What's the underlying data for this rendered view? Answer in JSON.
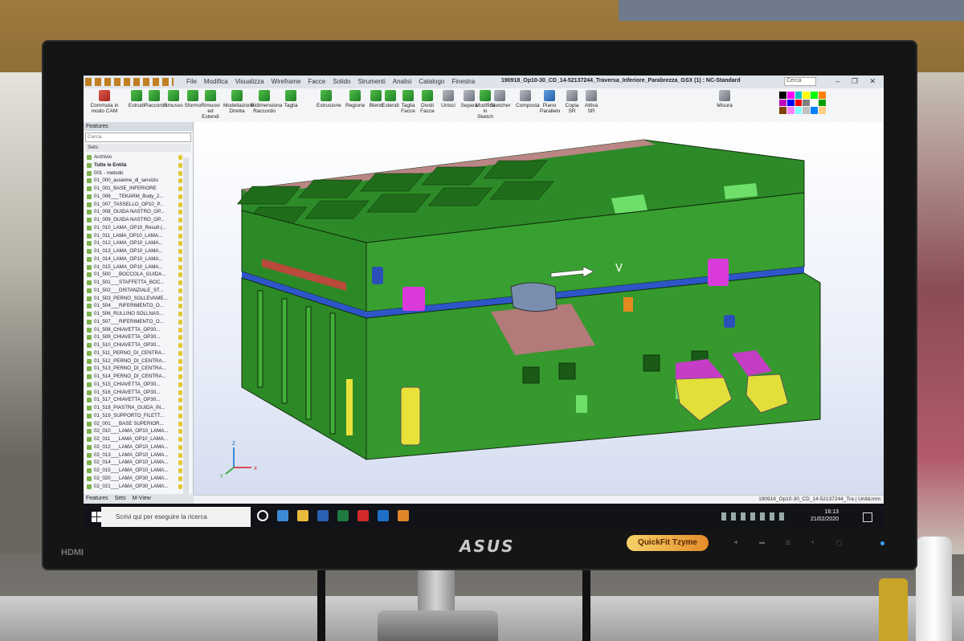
{
  "app": {
    "menu": [
      "File",
      "Modifica",
      "Visualizza",
      "Wireframe",
      "Facce",
      "Solido",
      "Strumenti",
      "Analisi",
      "Catalogo",
      "Finestra"
    ],
    "document_title": "190918_Op10-30_CD_14-52137244_Traversa_Inferiore_Parabrezza_GSX (1) : NC-Standard",
    "search_placeholder": "Cerca",
    "window_controls": "– ❐ ✕"
  },
  "ribbon": {
    "buttons": [
      {
        "label": "Commuta in modo CAM",
        "icon": "cam-switch-icon",
        "color": "red"
      },
      {
        "label": "Estrudi",
        "icon": "extrude-icon",
        "color": "green"
      },
      {
        "label": "Raccordo",
        "icon": "fillet-icon",
        "color": "green"
      },
      {
        "label": "Smusso",
        "icon": "chamfer-icon",
        "color": "green"
      },
      {
        "label": "Sformo",
        "icon": "draft-icon",
        "color": "green"
      },
      {
        "label": "Rimuovi ed Estendi",
        "icon": "remove-extend-icon",
        "color": "green"
      },
      {
        "label": "Modellazione Diretta",
        "icon": "direct-modeling-icon",
        "color": "green"
      },
      {
        "label": "Ridimensiona Raccordo",
        "icon": "resize-fillet-icon",
        "color": "green"
      },
      {
        "label": "Taglia",
        "icon": "cut-icon",
        "color": "green"
      },
      {
        "label": "Estrusione",
        "icon": "extrusion-icon",
        "color": "green"
      },
      {
        "label": "Regione",
        "icon": "region-icon",
        "color": "green"
      },
      {
        "label": "Blend",
        "icon": "blend-icon",
        "color": "green"
      },
      {
        "label": "Estendi",
        "icon": "extend-icon",
        "color": "green"
      },
      {
        "label": "Taglia Facce",
        "icon": "trim-faces-icon",
        "color": "green"
      },
      {
        "label": "Dividi Facce",
        "icon": "split-faces-icon",
        "color": "green"
      },
      {
        "label": "Unisci",
        "icon": "unite-icon",
        "color": "gray"
      },
      {
        "label": "Separa",
        "icon": "separate-icon",
        "color": "gray"
      },
      {
        "label": "Modifica in Sketch",
        "icon": "edit-sketch-icon",
        "color": "green"
      },
      {
        "label": "Sketcher",
        "icon": "sketcher-icon",
        "color": "gray"
      },
      {
        "label": "Composta",
        "icon": "composite-icon",
        "color": "gray"
      },
      {
        "label": "Piano Parallelo",
        "icon": "parallel-plane-icon",
        "color": "blue"
      },
      {
        "label": "Copia SR",
        "icon": "copy-sr-icon",
        "color": "gray"
      },
      {
        "label": "Attiva SR",
        "icon": "activate-sr-icon",
        "color": "gray"
      },
      {
        "label": "Misura",
        "icon": "measure-icon",
        "color": "gray"
      }
    ],
    "palette_colors": [
      "#000000",
      "#ff00ff",
      "#00c0c0",
      "#ffff00",
      "#00ff00",
      "#ff8000",
      "#c000c0",
      "#0000ff",
      "#ff0000",
      "#808080",
      "#ffffff",
      "#00a000",
      "#804000",
      "#ff80ff",
      "#80ffff",
      "#c0c0c0",
      "#0080ff",
      "#ffd080"
    ]
  },
  "features_panel": {
    "title": "Features",
    "search_placeholder": "Cerca",
    "sets_label": "Sets",
    "items": [
      "Archivio",
      "Tutte le Entità",
      "001 - metodo",
      "01_000_assieme_di_servizio",
      "01_001_BASE_INFERIORE",
      "01_006___TEKARM_Body_2...",
      "01_007_TASSELLO_OP10_P...",
      "01_008_GUIDA NASTRO_OP...",
      "01_009_GUIDA NASTRO_OP...",
      "01_010_LAMA_OP10_Result (...",
      "01_011_LAMA_OP10_LAMA...",
      "01_012_LAMA_OP10_LAMA...",
      "01_013_LAMA_OP10_LAMA...",
      "01_014_LAMA_OP10_LAMA...",
      "01_015_LAMA_OP10_LAMA...",
      "01_500___BOCCOLA_GUIDA...",
      "01_501___STAFFETTA_BOC...",
      "01_502___DISTANZIALE_ST...",
      "01_503_PERNO_SOLLEVAME...",
      "01_504___RIFERIMENTO_O...",
      "01_506_RULLINO SOLLNAS...",
      "01_507___RIFERIMENTO_O...",
      "01_508_CHIAVETTA_OP30...",
      "01_509_CHIAVETTA_OP30...",
      "01_510_CHIAVETTA_OP30...",
      "01_511_PERNO_DI_CENTRA...",
      "01_512_PERNO_DI_CENTRA...",
      "01_513_PERNO_DI_CENTRA...",
      "01_514_PERNO_DI_CENTRA...",
      "01_515_CHIAVETTA_OP30...",
      "01_516_CHIAVETTA_OP30...",
      "01_517_CHIAVETTA_OP30...",
      "01_518_PIASTRA_GUIDA_IN...",
      "01_519_SUPPORTO_FILETT...",
      "02_001___BASE SUPERIOR...",
      "02_010___LAMA_OP10_LAMA...",
      "02_011___LAMA_OP10_LAMA...",
      "02_012___LAMA_OP10_LAMA...",
      "02_013___LAMA_OP10_LAMA...",
      "02_014___LAMA_OP10_LAMA...",
      "02_015___LAMA_OP10_LAMA...",
      "02_020___LAMA_OP30_LAMA...",
      "02_021___LAMA_OP30_LAMA..."
    ],
    "tabs": [
      "Features",
      "Sets",
      "M-View"
    ]
  },
  "viewport": {
    "annotation_arrow_label": "V",
    "axis_labels": {
      "z": "Z",
      "y": "Y",
      "x": "X"
    }
  },
  "statusbar": {
    "file_label": "190918_Op10-30_CD_14-52137244_Tra",
    "units": "Unità:mm"
  },
  "taskbar": {
    "search_placeholder": "Scrivi qui per eseguire la ricerca",
    "time": "16:13",
    "date": "21/02/2020"
  },
  "monitor": {
    "brand": "ASUS",
    "port_label": "HDMI",
    "badge": "QuickFit Tzyme"
  }
}
